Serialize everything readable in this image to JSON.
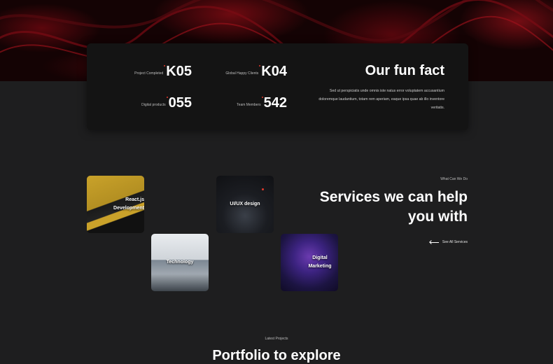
{
  "fun_fact": {
    "title": "Our fun fact",
    "description": "Sed ut perspiciatis unde omnis iste natus error voluptatem accusantium doloremque laudantium, totam rem aperiam, eaque ipsa quae ab illo inventore veritatis.",
    "stats": [
      {
        "label": "Project Completed",
        "value": "K05"
      },
      {
        "label": "Global Happy Clients",
        "value": "K04"
      },
      {
        "label": "Digital products",
        "value": "055"
      },
      {
        "label": "Team Members",
        "value": "542"
      }
    ]
  },
  "services": {
    "eyebrow": "What Can We Do",
    "title": "Services we can help you with",
    "see_all": "See All Services",
    "tiles": [
      {
        "label": "React.js Development"
      },
      {
        "label": "UI/UX design"
      },
      {
        "label": "Technology"
      },
      {
        "label": "Digital Marketing"
      }
    ]
  },
  "portfolio": {
    "eyebrow": "Latest Projects",
    "title": "Portfolio to explore"
  },
  "colors": {
    "accent": "#e23a2b",
    "background": "#1e1e1f",
    "card": "#141414"
  }
}
